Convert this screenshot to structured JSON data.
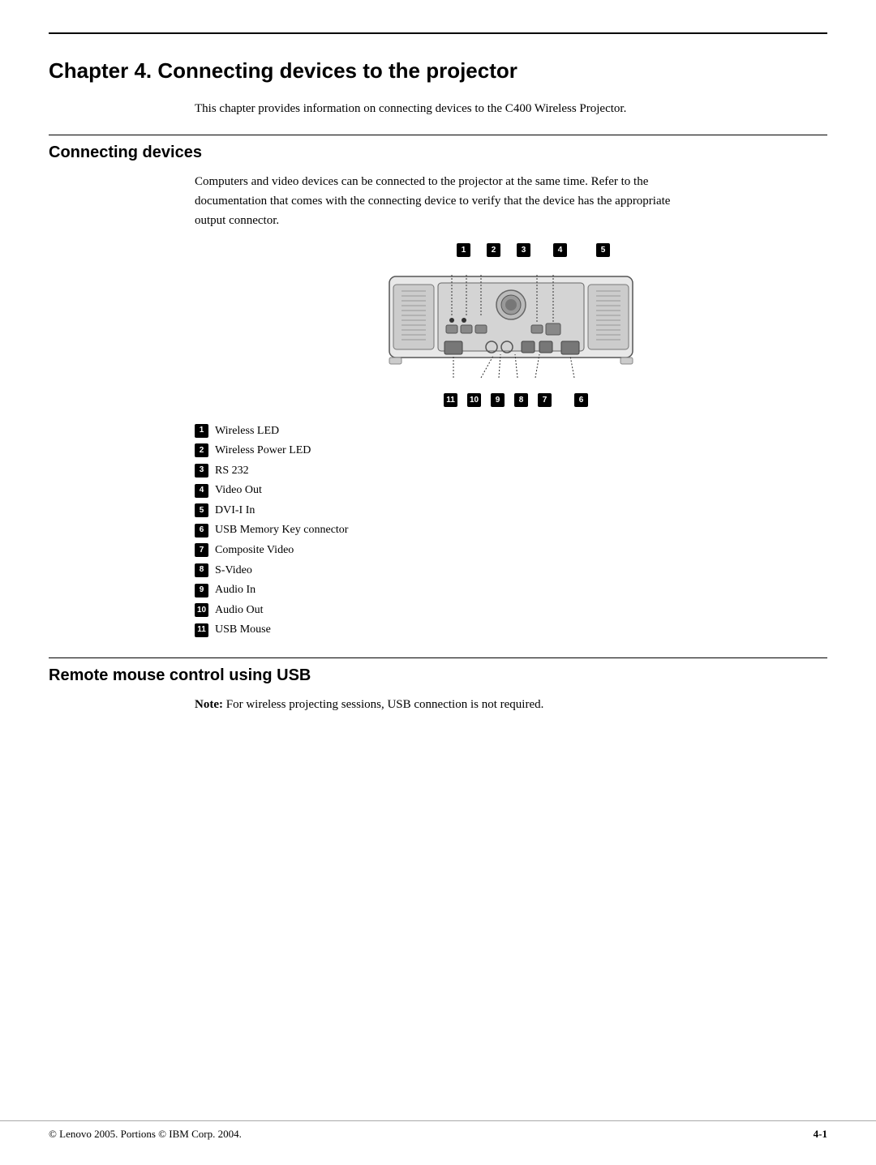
{
  "page": {
    "top_rule": true,
    "chapter_title": "Chapter 4. Connecting devices to the projector",
    "intro_text": "This chapter provides information on connecting devices to the C400 Wireless Projector.",
    "section1": {
      "title": "Connecting devices",
      "body_text": "Computers and video devices can be connected to the projector at the same time. Refer to the documentation that comes with the connecting device to verify that the device has the appropriate output connector.",
      "diagram_top_numbers": [
        "1",
        "2",
        "3",
        "4",
        "5"
      ],
      "diagram_bottom_numbers": [
        "11",
        "10",
        "9",
        "8",
        "7",
        "6"
      ],
      "legend": [
        {
          "num": "1",
          "label": "Wireless LED"
        },
        {
          "num": "2",
          "label": "Wireless Power LED"
        },
        {
          "num": "3",
          "label": "RS 232"
        },
        {
          "num": "4",
          "label": "Video Out"
        },
        {
          "num": "5",
          "label": "DVI-I In"
        },
        {
          "num": "6",
          "label": "USB Memory Key connector"
        },
        {
          "num": "7",
          "label": "Composite Video"
        },
        {
          "num": "8",
          "label": "S-Video"
        },
        {
          "num": "9",
          "label": "Audio In"
        },
        {
          "num": "10",
          "label": "Audio Out"
        },
        {
          "num": "11",
          "label": "USB Mouse"
        }
      ]
    },
    "section2": {
      "title": "Remote mouse control using USB",
      "note_label": "Note:",
      "note_text": "For wireless projecting sessions, USB connection is not required."
    },
    "footer": {
      "copyright": "© Lenovo 2005. Portions © IBM Corp.  2004.",
      "page_number": "4-1"
    }
  }
}
